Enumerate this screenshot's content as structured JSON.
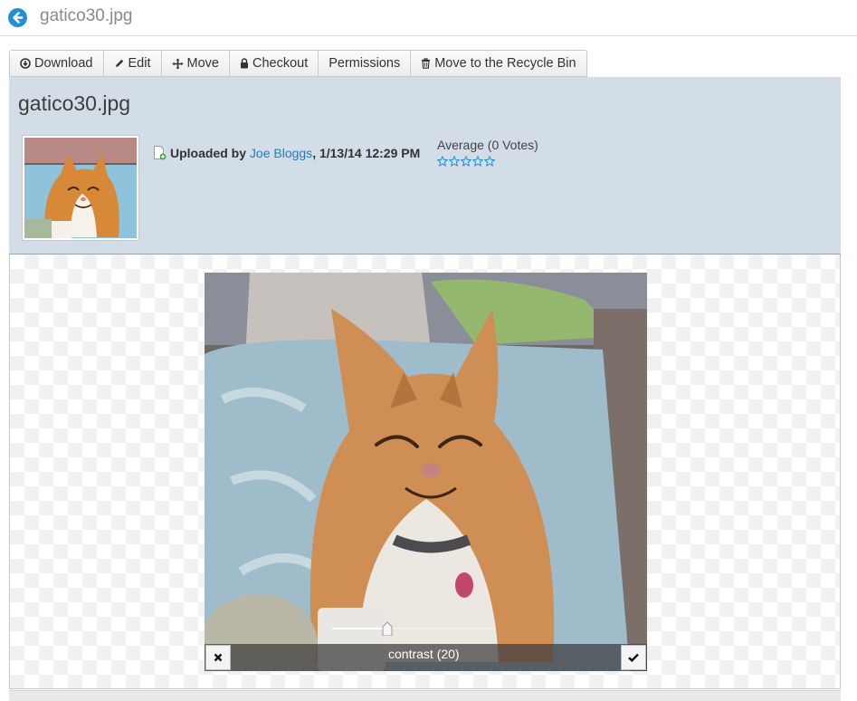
{
  "header": {
    "title": "gatico30.jpg",
    "back_icon": "arrow-left-circle-icon"
  },
  "toolbar": {
    "items": [
      {
        "label": "Download",
        "icon": "download-circle-icon"
      },
      {
        "label": "Edit",
        "icon": "pencil-icon"
      },
      {
        "label": "Move",
        "icon": "move-arrows-icon"
      },
      {
        "label": "Checkout",
        "icon": "lock-icon"
      },
      {
        "label": "Permissions",
        "icon": ""
      },
      {
        "label": "Move to the Recycle Bin",
        "icon": "trash-icon"
      }
    ]
  },
  "file": {
    "title": "gatico30.jpg",
    "uploaded_label": "Uploaded by",
    "author": "Joe Bloggs",
    "separator": ",",
    "date": "1/13/14 12:29 PM"
  },
  "rating": {
    "average_text": "Average (0 Votes)",
    "stars_total": 5,
    "stars_filled": 0
  },
  "editor": {
    "control_label": "contrast (20)",
    "contrast_fraction": 0.34,
    "cancel_icon": "close-icon",
    "confirm_icon": "check-icon"
  },
  "colors": {
    "accent": "#1e8fd8",
    "link": "#1a7dc4",
    "panel_bg": "#d3dde7"
  }
}
